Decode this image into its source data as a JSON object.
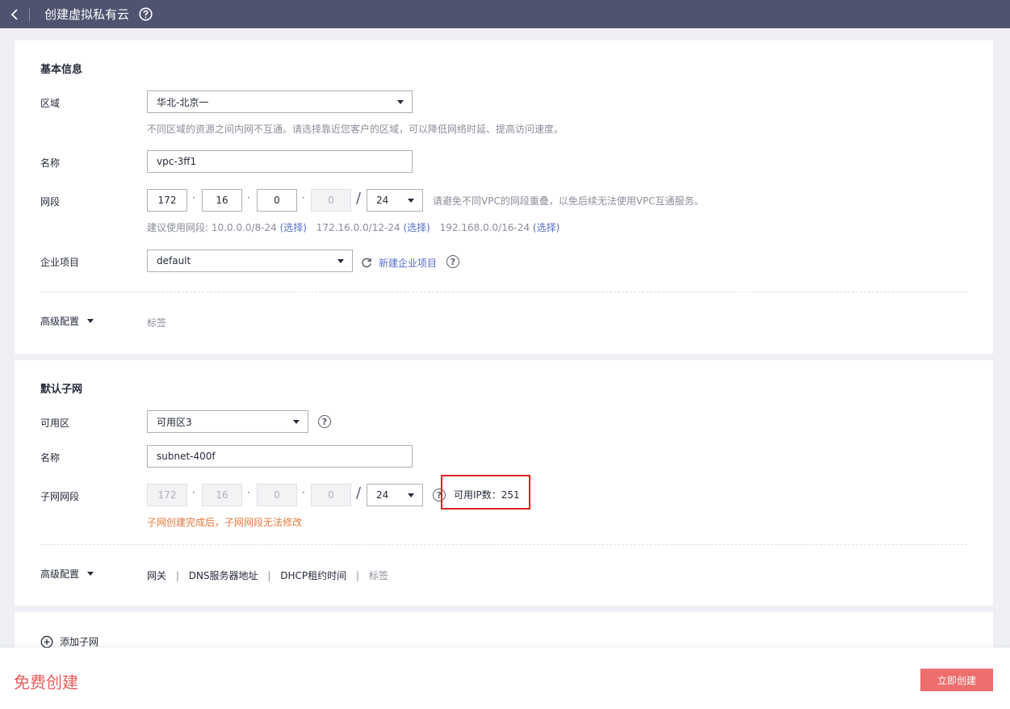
{
  "header": {
    "title": "创建虚拟私有云"
  },
  "basic": {
    "title": "基本信息",
    "region": {
      "label": "区域",
      "value": "华北-北京一",
      "hint": "不同区域的资源之间内网不互通。请选择靠近您客户的区域，可以降低网络时延、提高访问速度。"
    },
    "name": {
      "label": "名称",
      "value": "vpc-3ff1"
    },
    "cidr": {
      "label": "网段",
      "octets": [
        "172",
        "16",
        "0",
        "0"
      ],
      "mask": "24",
      "hint": "请避免不同VPC的网段重叠，以免后续无法使用VPC互通服务。",
      "suggest_prefix": "建议使用网段: 10.0.0.0/8-24",
      "suggest_1": "172.16.0.0/12-24",
      "suggest_2": "192.168.0.0/16-24",
      "choose": "(选择)"
    },
    "project": {
      "label": "企业项目",
      "value": "default",
      "new_link": "新建企业项目"
    },
    "advanced": {
      "label": "高级配置",
      "tag": "标签"
    }
  },
  "subnet": {
    "title": "默认子网",
    "az": {
      "label": "可用区",
      "value": "可用区3"
    },
    "name": {
      "label": "名称",
      "value": "subnet-400f"
    },
    "cidr": {
      "label": "子网网段",
      "octets": [
        "172",
        "16",
        "0",
        "0"
      ],
      "mask": "24",
      "available_ip": "可用IP数：251",
      "warning": "子网创建完成后，子网网段无法修改"
    },
    "advanced": {
      "label": "高级配置",
      "gateway": "网关",
      "dns": "DNS服务器地址",
      "dhcp": "DHCP租约时间",
      "tag": "标签",
      "sep": "|"
    }
  },
  "add_subnet": {
    "label": "添加子网"
  },
  "footer": {
    "free": "免费创建",
    "create": "立即创建"
  },
  "colors": {
    "topbar": "#4e5370",
    "accent_red": "#ee6d6d",
    "link": "#526ecc",
    "warn": "#e37a3b"
  }
}
